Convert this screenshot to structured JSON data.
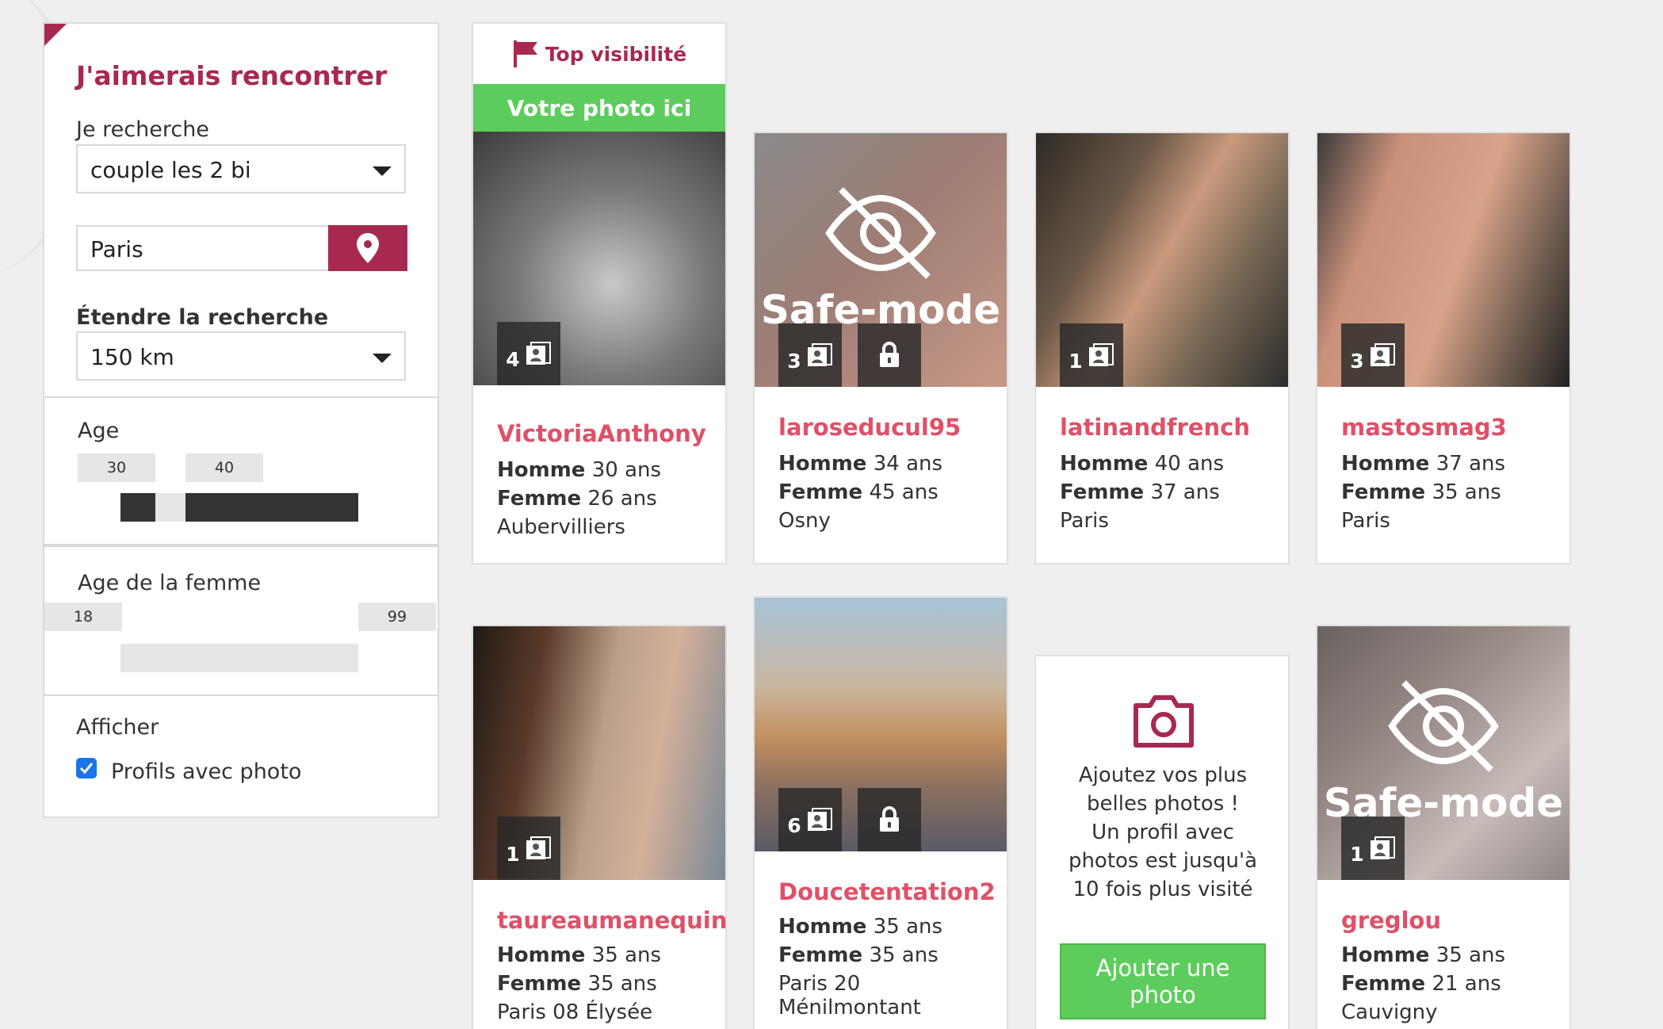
{
  "sidebar": {
    "title": "J'aimerais rencontrer",
    "search_label": "Je recherche",
    "search_value": "couple les 2 bi",
    "city_value": "Paris",
    "extend_label": "Étendre la recherche",
    "extend_value": "150 km",
    "age_title": "Age",
    "age_min": "30",
    "age_max": "40",
    "woman_age_title": "Age de la femme",
    "woman_age_min": "18",
    "woman_age_max": "99",
    "display_label": "Afficher",
    "photo_checkbox_label": "Profils avec photo",
    "photo_checkbox_checked": true
  },
  "top_card": {
    "heading": "Top visibilité",
    "banner": "Votre photo ici"
  },
  "profiles": [
    {
      "username": "VictoriaAnthony",
      "photos": "4",
      "locked": false,
      "safe_mode": false,
      "man_label": "Homme",
      "man_age": "30 ans",
      "woman_label": "Femme",
      "woman_age": "26 ans",
      "city": "Aubervilliers"
    },
    {
      "username": "laroseducul95",
      "photos": "3",
      "locked": true,
      "safe_mode": true,
      "man_label": "Homme",
      "man_age": "34 ans",
      "woman_label": "Femme",
      "woman_age": "45 ans",
      "city": "Osny"
    },
    {
      "username": "latinandfrench",
      "photos": "1",
      "locked": false,
      "safe_mode": false,
      "man_label": "Homme",
      "man_age": "40 ans",
      "woman_label": "Femme",
      "woman_age": "37 ans",
      "city": "Paris"
    },
    {
      "username": "mastosmag3",
      "photos": "3",
      "locked": false,
      "safe_mode": false,
      "man_label": "Homme",
      "man_age": "37 ans",
      "woman_label": "Femme",
      "woman_age": "35 ans",
      "city": "Paris"
    },
    {
      "username": "taureaumanequin",
      "photos": "1",
      "locked": false,
      "safe_mode": false,
      "man_label": "Homme",
      "man_age": "35 ans",
      "woman_label": "Femme",
      "woman_age": "35 ans",
      "city": "Paris 08 Élysée"
    },
    {
      "username": "Doucetentation2",
      "photos": "6",
      "locked": true,
      "safe_mode": false,
      "man_label": "Homme",
      "man_age": "35 ans",
      "woman_label": "Femme",
      "woman_age": "35 ans",
      "city": "Paris 20 Ménilmontant"
    },
    {
      "username": "greglou",
      "photos": "1",
      "locked": false,
      "safe_mode": true,
      "man_label": "Homme",
      "man_age": "35 ans",
      "woman_label": "Femme",
      "woman_age": "21 ans",
      "city": "Cauvigny"
    }
  ],
  "safe_mode_text": "Safe-mode",
  "add_photo_card": {
    "text_lines": [
      "Ajoutez vos plus",
      "belles photos !",
      "Un profil avec",
      "photos est jusqu'à",
      "10 fois plus visité"
    ],
    "button_line1": "Ajouter une",
    "button_line2": "photo"
  },
  "colors": {
    "accent": "#a8294f",
    "username": "#e05068",
    "green": "#5ccd5c"
  }
}
